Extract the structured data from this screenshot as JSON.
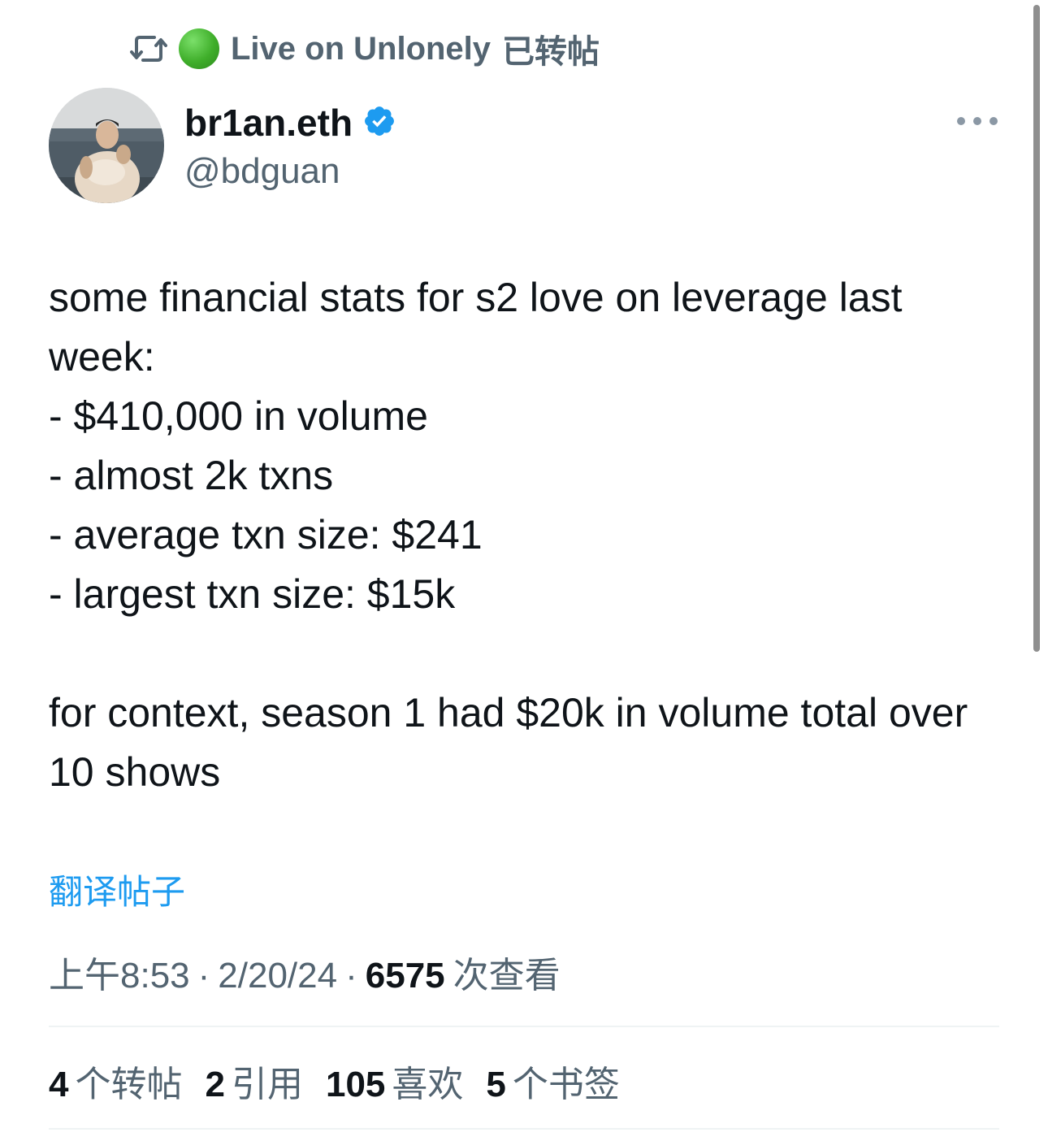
{
  "repost_banner": {
    "icon": "repost-icon",
    "status_icon": "green-circle",
    "reposter": "Live on Unlonely",
    "suffix": "已转帖"
  },
  "author": {
    "display_name": "br1an.eth",
    "handle": "@bdguan",
    "verified": true,
    "verified_color": "#1d9bf0"
  },
  "tweet": {
    "text": "some financial stats for s2 love on leverage last week:\n- $410,000 in volume\n- almost 2k txns\n- average txn size: $241\n- largest txn size: $15k\n\nfor context, season 1 had $20k in volume total over 10 shows"
  },
  "translate_link": "翻译帖子",
  "meta": {
    "time": "上午8:53",
    "date": "2/20/24",
    "separator": "·",
    "views_count": "6575",
    "views_label": "次查看"
  },
  "stats": [
    {
      "num": "4",
      "label": "个转帖"
    },
    {
      "num": "2",
      "label": "引用"
    },
    {
      "num": "105",
      "label": "喜欢"
    },
    {
      "num": "5",
      "label": "个书签"
    }
  ],
  "colors": {
    "link": "#1d9bf0",
    "secondary_text": "#536471",
    "primary_text": "#0f1419"
  }
}
